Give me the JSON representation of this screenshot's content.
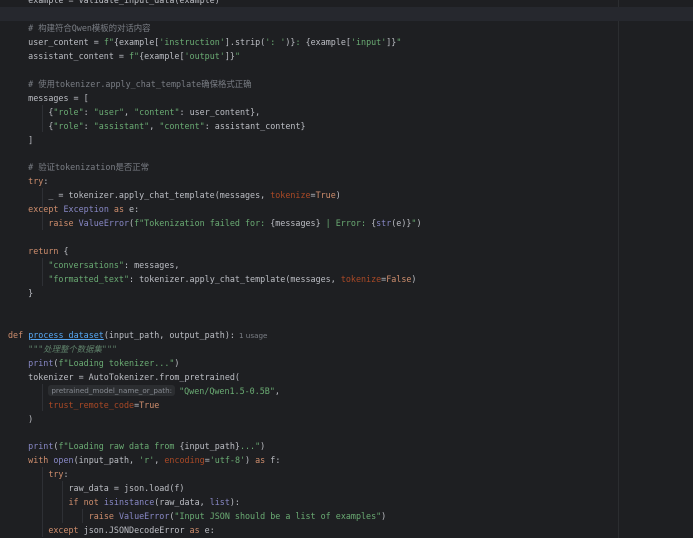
{
  "editor": {
    "lines": [
      {
        "tokens": [
          [
            "p",
            "    example = validate_input_data(example)"
          ]
        ]
      },
      {
        "tokens": []
      },
      {
        "tokens": [
          [
            "p",
            "    "
          ],
          [
            "cmt",
            "# 构建符合Qwen模板的对话内容"
          ]
        ]
      },
      {
        "tokens": [
          [
            "p",
            "    user_content = "
          ],
          [
            "str",
            "f\""
          ],
          [
            "p",
            "{example["
          ],
          [
            "str",
            "'instruction'"
          ],
          [
            "p",
            "].strip("
          ],
          [
            "str",
            "': '"
          ],
          [
            "p",
            ")}"
          ],
          [
            "str",
            ": "
          ],
          [
            "p",
            "{example["
          ],
          [
            "str",
            "'input'"
          ],
          [
            "p",
            "]}"
          ],
          [
            "str",
            "\""
          ]
        ]
      },
      {
        "tokens": [
          [
            "p",
            "    assistant_content = "
          ],
          [
            "str",
            "f\""
          ],
          [
            "p",
            "{example["
          ],
          [
            "str",
            "'output'"
          ],
          [
            "p",
            "]}"
          ],
          [
            "str",
            "\""
          ]
        ]
      },
      {
        "tokens": []
      },
      {
        "tokens": [
          [
            "p",
            "    "
          ],
          [
            "cmt",
            "# 使用tokenizer.apply_chat_template确保格式正确"
          ]
        ]
      },
      {
        "tokens": [
          [
            "p",
            "    messages = ["
          ]
        ]
      },
      {
        "tokens": [
          [
            "p",
            "        {"
          ],
          [
            "str",
            "\"role\""
          ],
          [
            "p",
            ": "
          ],
          [
            "str",
            "\"user\""
          ],
          [
            "p",
            ", "
          ],
          [
            "str",
            "\"content\""
          ],
          [
            "p",
            ": user_content},"
          ]
        ]
      },
      {
        "tokens": [
          [
            "p",
            "        {"
          ],
          [
            "str",
            "\"role\""
          ],
          [
            "p",
            ": "
          ],
          [
            "str",
            "\"assistant\""
          ],
          [
            "p",
            ", "
          ],
          [
            "str",
            "\"content\""
          ],
          [
            "p",
            ": assistant_content}"
          ]
        ]
      },
      {
        "tokens": [
          [
            "p",
            "    ]"
          ]
        ]
      },
      {
        "tokens": []
      },
      {
        "tokens": [
          [
            "p",
            "    "
          ],
          [
            "cmt",
            "# 验证tokenization是否正常"
          ]
        ]
      },
      {
        "tokens": [
          [
            "p",
            "    "
          ],
          [
            "kw",
            "try"
          ],
          [
            "p",
            ":"
          ]
        ]
      },
      {
        "tokens": [
          [
            "p",
            "        _ = tokenizer.apply_chat_template(messages, "
          ],
          [
            "param",
            "tokenize"
          ],
          [
            "p",
            "="
          ],
          [
            "kw",
            "True"
          ],
          [
            "p",
            ")"
          ]
        ]
      },
      {
        "tokens": [
          [
            "p",
            "    "
          ],
          [
            "kw",
            "except"
          ],
          [
            "p",
            " "
          ],
          [
            "ex",
            "Exception"
          ],
          [
            "p",
            " "
          ],
          [
            "kw",
            "as"
          ],
          [
            "p",
            " e:"
          ]
        ]
      },
      {
        "tokens": [
          [
            "p",
            "        "
          ],
          [
            "kw",
            "raise"
          ],
          [
            "p",
            " "
          ],
          [
            "ex",
            "ValueError"
          ],
          [
            "p",
            "("
          ],
          [
            "str",
            "f\"Tokenization failed for: "
          ],
          [
            "p",
            "{messages}"
          ],
          [
            "str",
            " | Error: "
          ],
          [
            "p",
            "{"
          ],
          [
            "bi",
            "str"
          ],
          [
            "p",
            "(e)}"
          ],
          [
            "str",
            "\""
          ],
          [
            "p",
            ")"
          ]
        ]
      },
      {
        "tokens": []
      },
      {
        "tokens": [
          [
            "p",
            "    "
          ],
          [
            "kw",
            "return"
          ],
          [
            "p",
            " {"
          ]
        ]
      },
      {
        "tokens": [
          [
            "p",
            "        "
          ],
          [
            "str",
            "\"conversations\""
          ],
          [
            "p",
            ": messages,"
          ]
        ]
      },
      {
        "tokens": [
          [
            "p",
            "        "
          ],
          [
            "str",
            "\"formatted_text\""
          ],
          [
            "p",
            ": tokenizer.apply_chat_template(messages, "
          ],
          [
            "param",
            "tokenize"
          ],
          [
            "p",
            "="
          ],
          [
            "kw",
            "False"
          ],
          [
            "p",
            ")"
          ]
        ]
      },
      {
        "tokens": [
          [
            "p",
            "    }"
          ]
        ]
      },
      {
        "tokens": []
      },
      {
        "tokens": []
      },
      {
        "tokens": [
          [
            "kw",
            "def"
          ],
          [
            "p",
            " "
          ],
          [
            "fn",
            "process_dataset"
          ],
          [
            "p",
            "(input_path, output_path):"
          ],
          [
            "usage",
            "1 usage"
          ]
        ]
      },
      {
        "tokens": [
          [
            "p",
            "    "
          ],
          [
            "doc",
            "\"\"\"处理整个数据集\"\"\""
          ]
        ]
      },
      {
        "tokens": [
          [
            "p",
            "    "
          ],
          [
            "bi",
            "print"
          ],
          [
            "p",
            "("
          ],
          [
            "str",
            "f\"Loading tokenizer...\""
          ],
          [
            "p",
            ")"
          ]
        ]
      },
      {
        "tokens": [
          [
            "p",
            "    tokenizer = AutoTokenizer.from_pretrained("
          ]
        ]
      },
      {
        "tokens": [
          [
            "p",
            "        "
          ],
          [
            "hint",
            "pretrained_model_name_or_path:"
          ],
          [
            "str",
            "\"Qwen/Qwen1.5-0.5B\""
          ],
          [
            "p",
            ","
          ]
        ]
      },
      {
        "tokens": [
          [
            "p",
            "        "
          ],
          [
            "param",
            "trust_remote_code"
          ],
          [
            "p",
            "="
          ],
          [
            "kw",
            "True"
          ]
        ]
      },
      {
        "tokens": [
          [
            "p",
            "    )"
          ]
        ]
      },
      {
        "tokens": []
      },
      {
        "tokens": [
          [
            "p",
            "    "
          ],
          [
            "bi",
            "print"
          ],
          [
            "p",
            "("
          ],
          [
            "str",
            "f\"Loading raw data from "
          ],
          [
            "p",
            "{input_path}"
          ],
          [
            "str",
            "...\""
          ],
          [
            "p",
            ")"
          ]
        ]
      },
      {
        "tokens": [
          [
            "p",
            "    "
          ],
          [
            "kw",
            "with"
          ],
          [
            "p",
            " "
          ],
          [
            "bi",
            "open"
          ],
          [
            "p",
            "(input_path, "
          ],
          [
            "str",
            "'r'"
          ],
          [
            "p",
            ", "
          ],
          [
            "param",
            "encoding"
          ],
          [
            "p",
            "="
          ],
          [
            "str",
            "'utf-8'"
          ],
          [
            "p",
            ") "
          ],
          [
            "kw",
            "as"
          ],
          [
            "p",
            " f:"
          ]
        ]
      },
      {
        "tokens": [
          [
            "p",
            "        "
          ],
          [
            "kw",
            "try"
          ],
          [
            "p",
            ":"
          ]
        ]
      },
      {
        "tokens": [
          [
            "p",
            "            raw_data = json.load(f)"
          ]
        ]
      },
      {
        "tokens": [
          [
            "p",
            "            "
          ],
          [
            "kw",
            "if not"
          ],
          [
            "p",
            " "
          ],
          [
            "bi",
            "isinstance"
          ],
          [
            "p",
            "(raw_data, "
          ],
          [
            "bi",
            "list"
          ],
          [
            "p",
            "):"
          ]
        ]
      },
      {
        "tokens": [
          [
            "p",
            "                "
          ],
          [
            "kw",
            "raise"
          ],
          [
            "p",
            " "
          ],
          [
            "ex",
            "ValueError"
          ],
          [
            "p",
            "("
          ],
          [
            "str",
            "\"Input JSON should be a list of examples\""
          ],
          [
            "p",
            ")"
          ]
        ]
      },
      {
        "tokens": [
          [
            "p",
            "        "
          ],
          [
            "kw",
            "except"
          ],
          [
            "p",
            " json.JSONDecodeError "
          ],
          [
            "kw",
            "as"
          ],
          [
            "p",
            " e:"
          ]
        ]
      }
    ]
  },
  "colors": {
    "background": "#1e1f22",
    "keyword": "#cf8e6d",
    "string": "#6aab73",
    "comment": "#7a7e85",
    "function": "#56a8f5",
    "parameter": "#aa4926",
    "builtin": "#8888c6"
  }
}
